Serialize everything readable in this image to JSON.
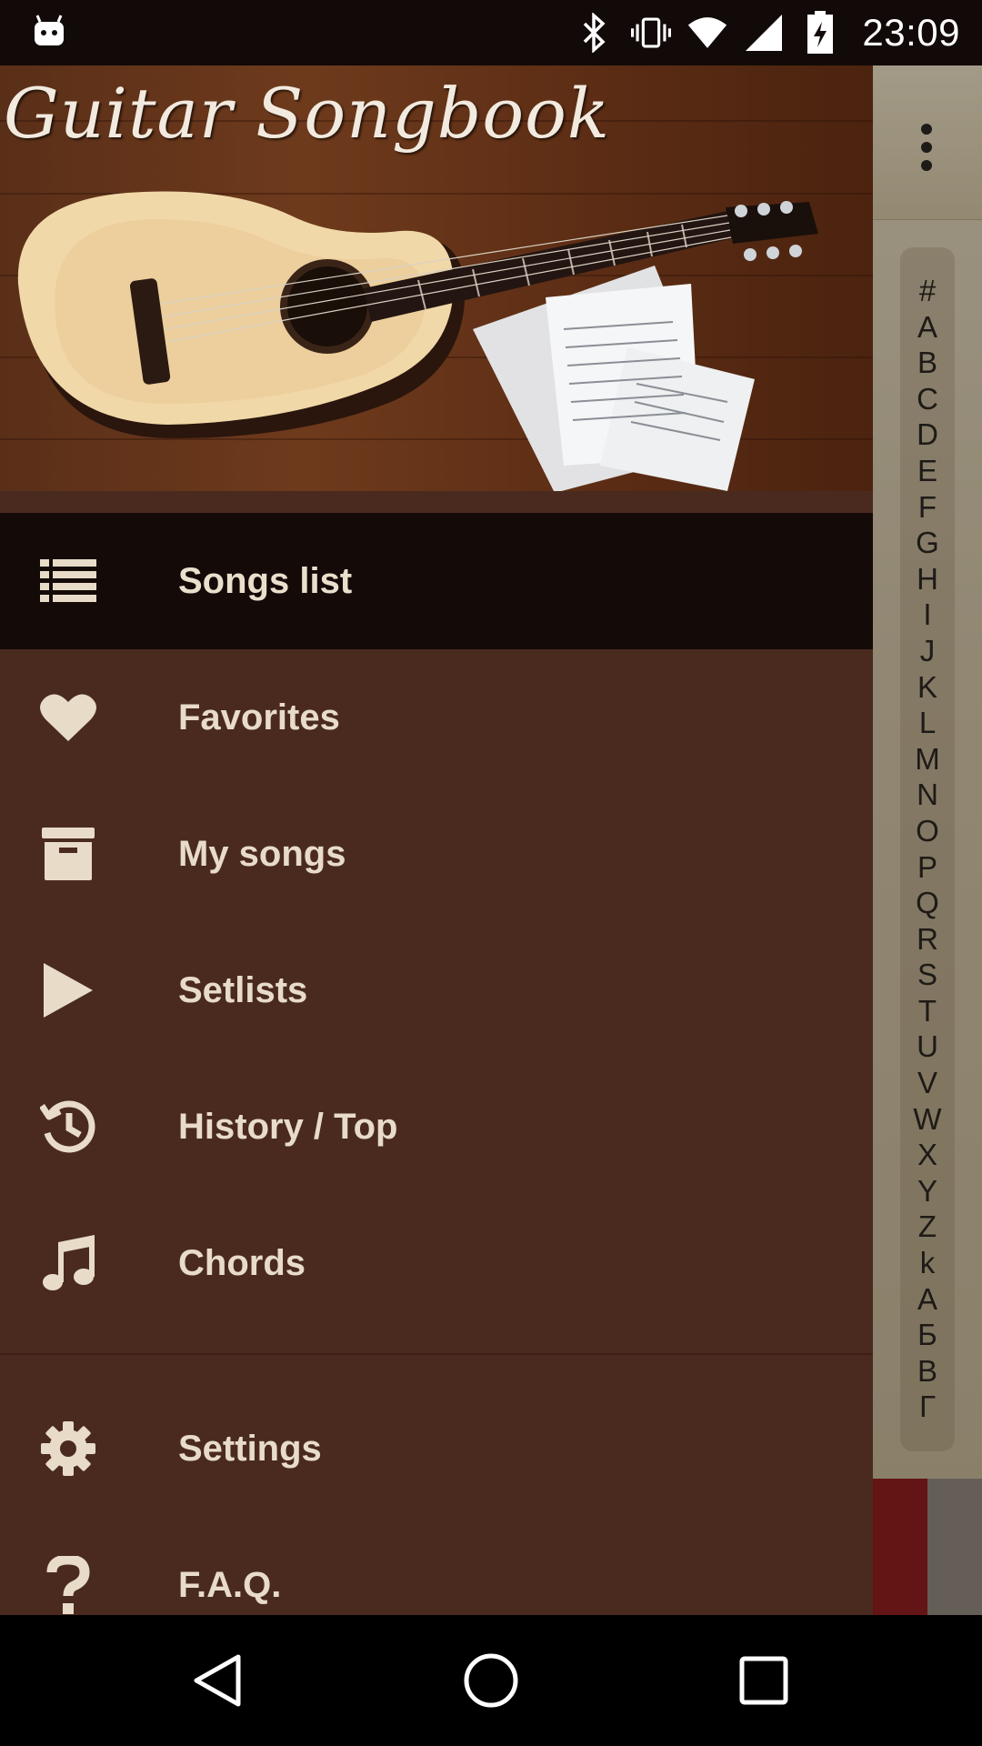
{
  "status_bar": {
    "time": "23:09",
    "icons": [
      "android-debug-icon",
      "bluetooth-icon",
      "vibrate-icon",
      "wifi-icon",
      "cell-signal-icon",
      "battery-charging-icon"
    ]
  },
  "drawer": {
    "header_title": "Guitar Songbook",
    "items": [
      {
        "label": "Songs list",
        "icon": "list-icon",
        "active": true
      },
      {
        "label": "Favorites",
        "icon": "heart-icon",
        "active": false
      },
      {
        "label": "My songs",
        "icon": "archive-box-icon",
        "active": false
      },
      {
        "label": "Setlists",
        "icon": "play-icon",
        "active": false
      },
      {
        "label": "History / Top",
        "icon": "history-icon",
        "active": false
      },
      {
        "label": "Chords",
        "icon": "music-note-icon",
        "active": false
      }
    ],
    "secondary_items": [
      {
        "label": "Settings",
        "icon": "gear-icon"
      },
      {
        "label": "F.A.Q.",
        "icon": "question-icon"
      }
    ]
  },
  "background_app": {
    "alpha_index": [
      "#",
      "A",
      "B",
      "C",
      "D",
      "E",
      "F",
      "G",
      "H",
      "I",
      "J",
      "K",
      "L",
      "M",
      "N",
      "O",
      "P",
      "Q",
      "R",
      "S",
      "T",
      "U",
      "V",
      "W",
      "X",
      "Y",
      "Z",
      "k",
      "А",
      "Б",
      "В",
      "Г"
    ]
  },
  "colors": {
    "drawer_bg": "#4a2a1f",
    "active_item_bg": "#140a08",
    "text": "#e8dcc8",
    "status_bar_bg": "#120a08"
  }
}
